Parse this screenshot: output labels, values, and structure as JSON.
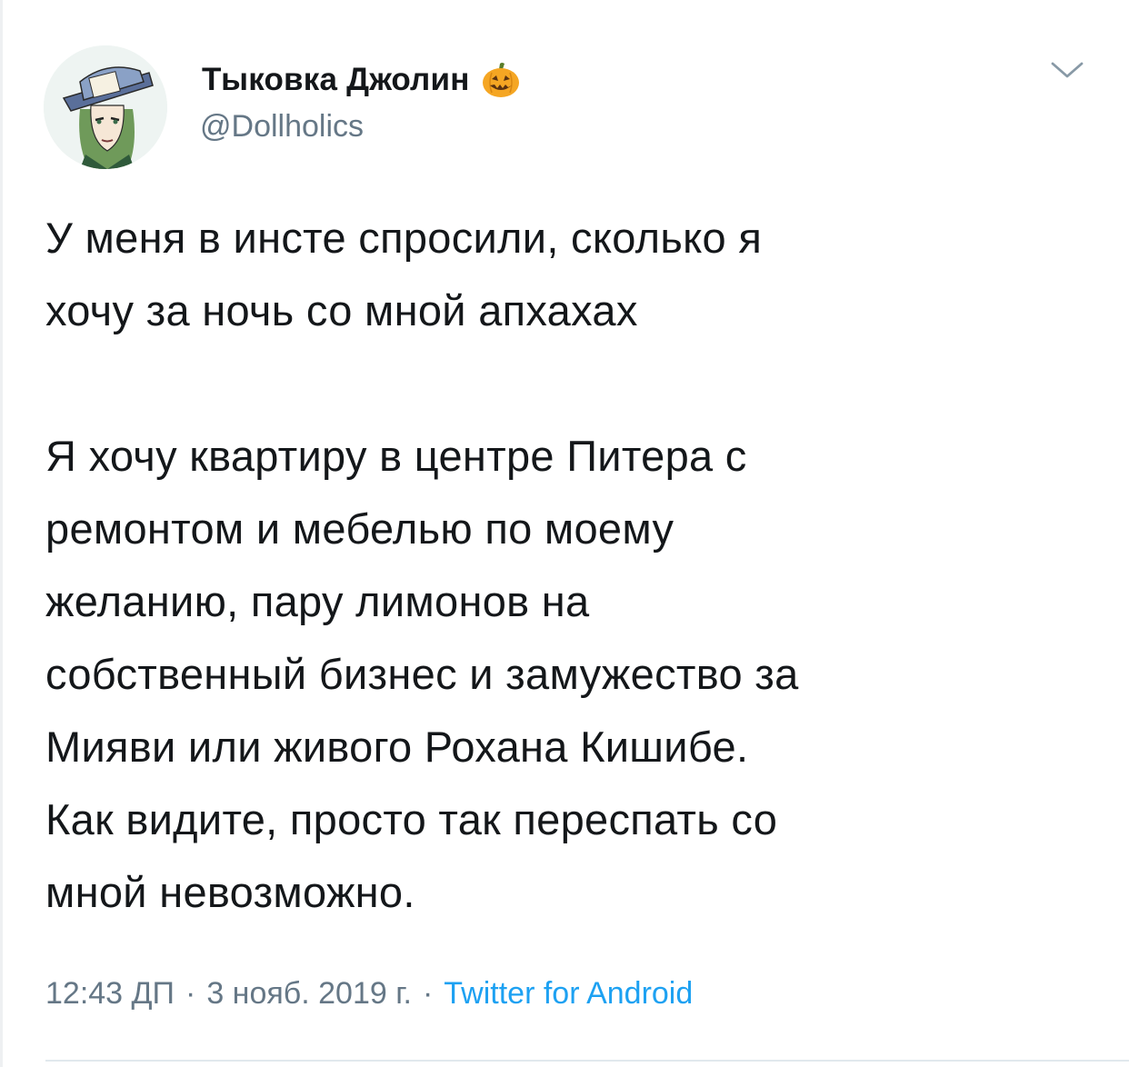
{
  "author": {
    "display_name": "Тыковка Джолин",
    "handle": "@Dollholics",
    "avatar_icon": "anime-avatar-icon",
    "name_emoji_icon": "jack-o-lantern-icon"
  },
  "tweet": {
    "paragraph1": [
      "У меня в инсте спросили, сколько я",
      "хочу за ночь со мной апхахах"
    ],
    "paragraph2": [
      "Я хочу квартиру в центре Питера с",
      "ремонтом и мебелью по моему",
      "желанию, пару лимонов на",
      "собственный бизнес и замужество за",
      "Мияви или живого Рохана Кишибе.",
      "Как видите, просто так переспать со",
      "мной невозможно."
    ]
  },
  "meta": {
    "time": "12:43 ДП",
    "separator": "·",
    "date": "3 нояб. 2019 г.",
    "source": "Twitter for Android"
  },
  "controls": {
    "menu_icon": "chevron-down-icon"
  },
  "colors": {
    "text": "#14171a",
    "secondary": "#657786",
    "link": "#1da1f2",
    "divider": "#e1e8ed"
  }
}
